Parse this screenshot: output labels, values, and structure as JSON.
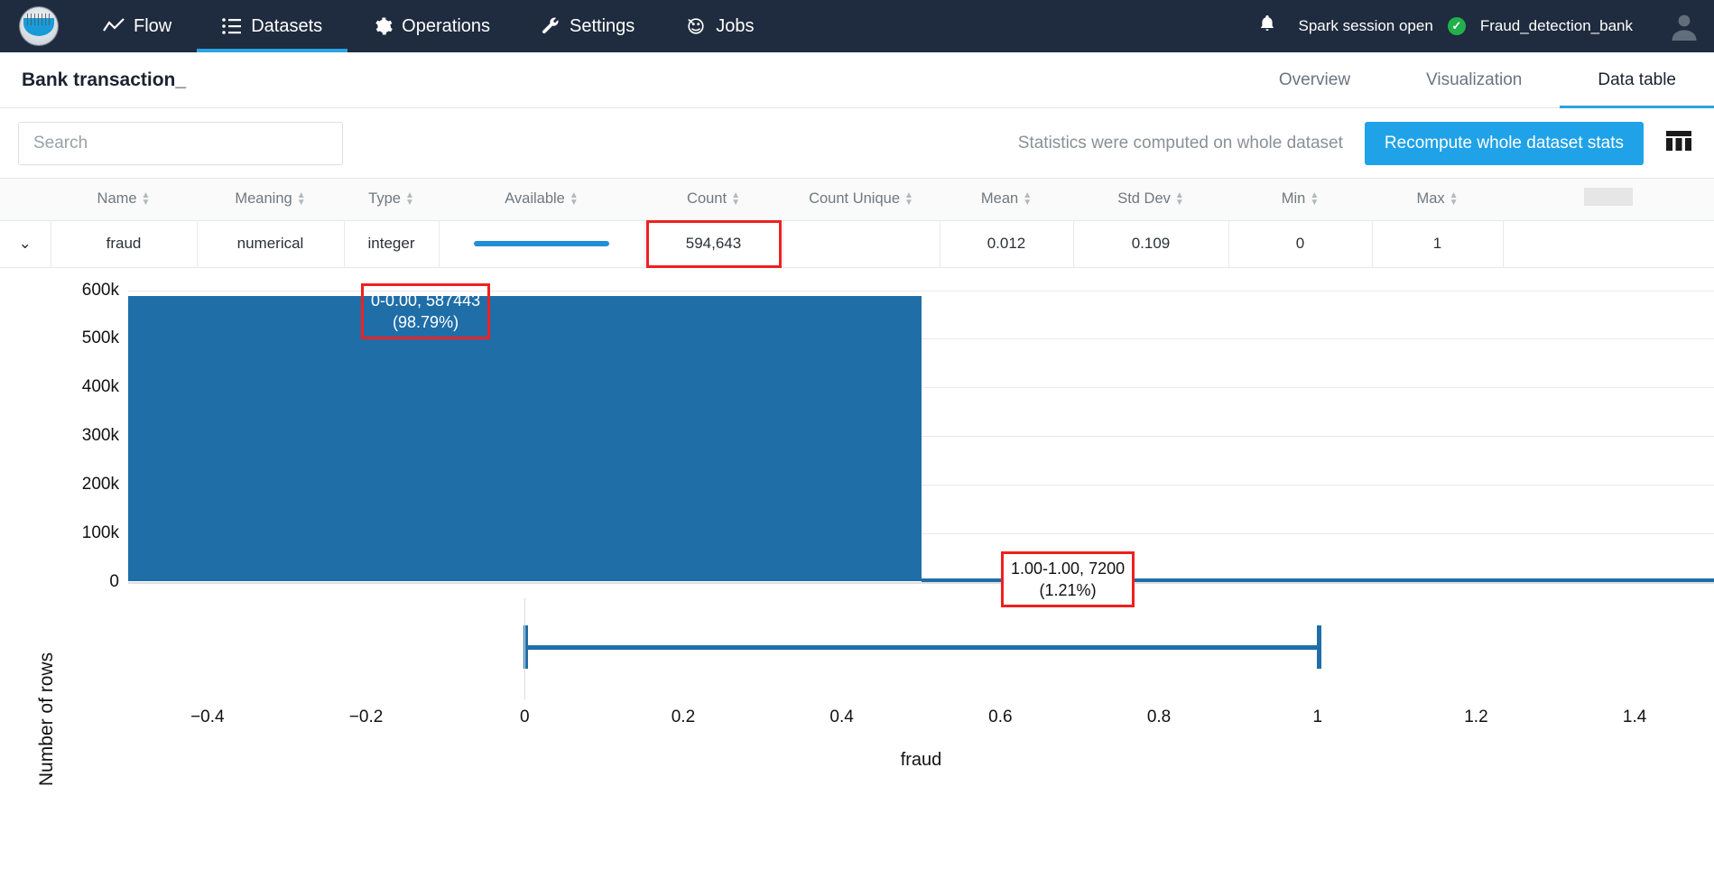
{
  "nav": {
    "logo_icon": "dataiku-logo-icon",
    "items": [
      {
        "id": "flow",
        "label": "Flow",
        "icon": "flow-icon",
        "active": false
      },
      {
        "id": "datasets",
        "label": "Datasets",
        "icon": "list-icon",
        "active": true
      },
      {
        "id": "operations",
        "label": "Operations",
        "icon": "gear-icon",
        "active": false
      },
      {
        "id": "settings",
        "label": "Settings",
        "icon": "wrench-icon",
        "active": false
      },
      {
        "id": "jobs",
        "label": "Jobs",
        "icon": "jobs-icon",
        "active": false
      }
    ],
    "bell_icon": "notification-bell-icon",
    "session_status": "Spark session open",
    "session_ok_icon": "check-circle-icon",
    "project_name": "Fraud_detection_bank",
    "avatar_icon": "user-avatar-icon"
  },
  "page": {
    "title": "Bank transaction_",
    "tabs": [
      {
        "id": "overview",
        "label": "Overview",
        "active": false
      },
      {
        "id": "visualization",
        "label": "Visualization",
        "active": false
      },
      {
        "id": "data-table",
        "label": "Data table",
        "active": true
      }
    ]
  },
  "toolbar": {
    "search_value": "",
    "search_placeholder": "Search",
    "stats_note": "Statistics were computed on whole dataset",
    "recompute_label": "Recompute whole dataset stats",
    "grid_icon": "table-columns-icon"
  },
  "table": {
    "columns": [
      {
        "key": "chevron",
        "label": ""
      },
      {
        "key": "name",
        "label": "Name"
      },
      {
        "key": "meaning",
        "label": "Meaning"
      },
      {
        "key": "type",
        "label": "Type"
      },
      {
        "key": "available",
        "label": "Available"
      },
      {
        "key": "count",
        "label": "Count"
      },
      {
        "key": "count_unique",
        "label": "Count Unique"
      },
      {
        "key": "mean",
        "label": "Mean"
      },
      {
        "key": "std_dev",
        "label": "Std Dev"
      },
      {
        "key": "min",
        "label": "Min"
      },
      {
        "key": "max",
        "label": "Max"
      },
      {
        "key": "extra",
        "label": ""
      }
    ],
    "rows": [
      {
        "chevron": "⌄",
        "name": "fraud",
        "meaning": "numerical",
        "type": "integer",
        "available_pct": 100,
        "count": "594,643",
        "count_unique": "",
        "mean": "0.012",
        "std_dev": "0.109",
        "min": "0",
        "max": "1",
        "extra": "",
        "highlight": "count"
      }
    ]
  },
  "chart_data": {
    "type": "bar",
    "title": "",
    "xlabel": "fraud",
    "ylabel": "Number of rows",
    "xlim": [
      -0.5,
      1.5
    ],
    "ylim": [
      0,
      600000
    ],
    "grid": true,
    "legend": null,
    "xticks": [
      "−0.4",
      "−0.2",
      "0",
      "0.2",
      "0.4",
      "0.6",
      "0.8",
      "1",
      "1.2",
      "1.4"
    ],
    "xtick_values": [
      -0.4,
      -0.2,
      0,
      0.2,
      0.4,
      0.6,
      0.8,
      1,
      1.2,
      1.4
    ],
    "yticks": [
      "0",
      "100k",
      "200k",
      "300k",
      "400k",
      "500k",
      "600k"
    ],
    "ytick_values": [
      0,
      100000,
      200000,
      300000,
      400000,
      500000,
      600000
    ],
    "bin_edges": [
      -0.5,
      0.5,
      1.5
    ],
    "categories": [
      "0-0.00",
      "1.00-1.00"
    ],
    "values": [
      587443,
      7200
    ],
    "bar_color": "#1f6ea8",
    "annotations": [
      {
        "id": "bin-0",
        "line1": "0-0.00,   587443",
        "line2": "(98.79%)",
        "value": 587443,
        "pct": "98.79%"
      },
      {
        "id": "bin-1",
        "line1": "1.00-1.00,  7200",
        "line2": "(1.21%)",
        "value": 7200,
        "pct": "1.21%"
      }
    ],
    "boxplot": {
      "min": 0,
      "max": 1,
      "median": 0,
      "q1": 0,
      "q3": 0
    }
  }
}
